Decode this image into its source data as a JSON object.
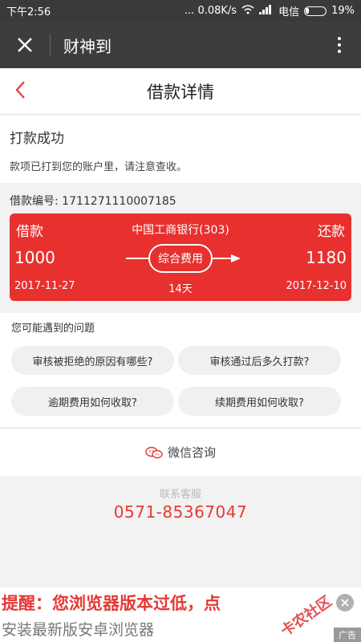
{
  "status_bar": {
    "time": "下午2:56",
    "speed": "... 0.08K/s",
    "carrier": "电信",
    "battery": "19%"
  },
  "app_bar": {
    "title": "财神到"
  },
  "page": {
    "title": "借款详情"
  },
  "success": {
    "title": "打款成功",
    "desc": "款项已打到您的账户里，请注意查收。"
  },
  "loan": {
    "id_label": "借款编号: 1711271110007185",
    "borrow_label": "借款",
    "bank": "中国工商银行(303)",
    "repay_label": "还款",
    "borrow_amount": "1000",
    "fee_label": "综合费用",
    "repay_amount": "1180",
    "start_date": "2017-11-27",
    "duration": "14天",
    "end_date": "2017-12-10"
  },
  "faq": {
    "title": "您可能遇到的问题",
    "questions": [
      "审核被拒绝的原因有哪些?",
      "审核通过后多久打款?",
      "逾期费用如何收取?",
      "续期费用如何收取?"
    ]
  },
  "wechat": {
    "label": "微信咨询"
  },
  "service": {
    "label": "联系客服",
    "phone": "0571-85367047"
  },
  "ad": {
    "line1": "提醒：您浏览器版本过低，点",
    "line2": "安装最新版安卓浏览器",
    "tag": "广告",
    "watermark": "卡农社区"
  },
  "colors": {
    "accent": "#e53935",
    "card": "#e8302f",
    "app_bar": "#3d3d3d"
  }
}
